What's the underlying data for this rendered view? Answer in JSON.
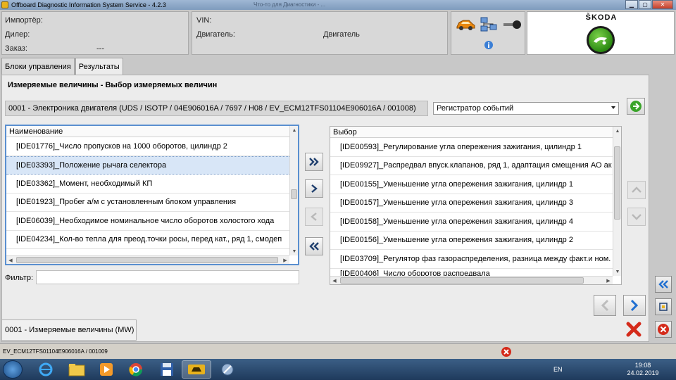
{
  "window": {
    "title": "Offboard Diagnostic Information System Service - 4.2.3",
    "background_title": "Что-то для Диагностики - ..."
  },
  "header": {
    "importer_label": "Импортёр:",
    "dealer_label": "Дилер:",
    "order_label": "Заказ:",
    "order_value": "---",
    "vin_label": "VIN:",
    "engine_label": "Двигатель:",
    "engine_value": "Двигатель",
    "brand": "ŠKODA"
  },
  "tabs": [
    {
      "label": "Блоки управления",
      "active": false
    },
    {
      "label": "Результаты",
      "active": true
    }
  ],
  "main": {
    "section_title": "Измеряемые величины - Выбор измеряемых величин",
    "ecu_info": "0001 - Электроника двигателя  (UDS / ISOTP / 04E906016A / 7697 / H08 / EV_ECM12TFS01104E906016A / 001008)",
    "dropdown_value": "Регистратор событий",
    "left_list": {
      "header": "Наименование",
      "items": [
        "[IDE01776]_Число пропусков на 1000 оборотов, цилиндр 2",
        "[IDE03393]_Положение рычага селектора",
        "[IDE03362]_Момент, необходимый КП",
        "[IDE01923]_Пробег а/м с установленным блоком управления",
        "[IDE06039]_Необходимое номинальное число оборотов холостого хода",
        "[IDE04234]_Кол-во тепла для преод.точки росы, перед кат., ряд 1, смодеп"
      ],
      "selected_index": 1
    },
    "right_list": {
      "header": "Выбор",
      "items": [
        "[IDE00593]_Регулирование угла опережения зажигания, цилиндр 1",
        "[IDE09927]_Распредвал впуск.клапанов, ряд 1, адаптация смещения АО ак",
        "[IDE00155]_Уменьшение угла опережения зажигания, цилиндр 1",
        "[IDE00157]_Уменьшение угла опережения зажигания, цилиндр 3",
        "[IDE00158]_Уменьшение угла опережения зажигания, цилиндр 4",
        "[IDE00156]_Уменьшение угла опережения зажигания, цилиндр 2",
        "[IDE03709]_Регулятор фаз газораспределения, разница между факт.и ном.",
        "[IDE00406]_Число оборотов распредвала"
      ]
    },
    "filter_label": "Фильтр:",
    "filter_value": ""
  },
  "status_tab": "0001 - Измеряемые величины (MW)",
  "statusbar": {
    "text": "EV_ECM12TFS01104E906016A / 001009"
  },
  "taskbar": {
    "language": "EN",
    "time": "19:08",
    "date": "24.02.2019"
  },
  "colors": {
    "selection": "#d8e6f7",
    "focus_border": "#5a8fd0",
    "accent_blue": "#1f6fd1",
    "error_red": "#d42a1a",
    "go_green": "#3aa42a"
  }
}
